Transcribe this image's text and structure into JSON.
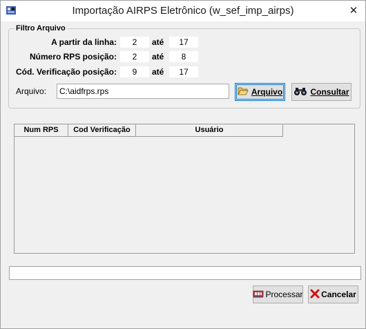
{
  "window": {
    "title": "Importação AIRPS Eletrônico (w_sef_imp_airps)",
    "close_glyph": "✕"
  },
  "filtro": {
    "title": "Filtro Arquivo",
    "rows": [
      {
        "label": "A partir da linha:",
        "from": "2",
        "ate": "até",
        "to": "17"
      },
      {
        "label": "Número RPS posição:",
        "from": "2",
        "ate": "até",
        "to": "8"
      },
      {
        "label": "Cód. Verificação posição:",
        "from": "9",
        "ate": "até",
        "to": "17"
      }
    ],
    "arquivo_label": "Arquivo:",
    "arquivo_value": "C:\\aidfrps.rps",
    "btn_arquivo": "Arquivo",
    "btn_consultar": "Consultar"
  },
  "grid": {
    "columns": [
      "Num RPS",
      "Cod Verificação",
      "Usuário"
    ]
  },
  "actions": {
    "processar": "Processar",
    "cancelar": "Cancelar"
  },
  "colors": {
    "window_bg": "#f0f0f0",
    "focus_border": "#0078d7"
  },
  "icons": {
    "app": "app-icon",
    "arquivo": "folder-open-icon",
    "consultar": "binoculars-icon",
    "processar": "process-icon",
    "cancelar": "red-x-icon"
  }
}
